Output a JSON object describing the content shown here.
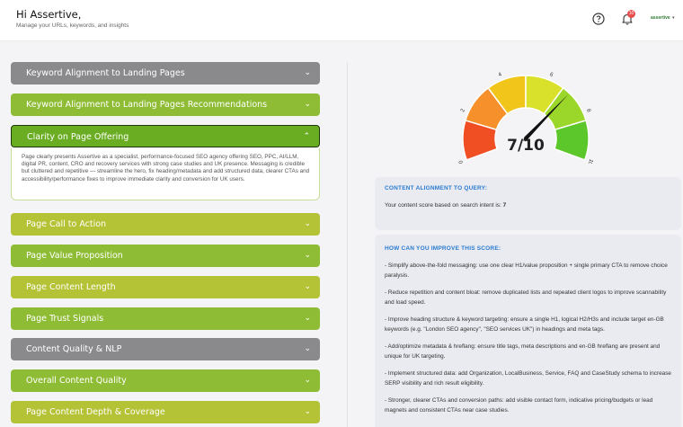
{
  "header": {
    "greeting": "Hi Assertive,",
    "subtitle": "Manage your URLs, keywords, and insights",
    "notification_count": "10",
    "username": "assertive",
    "help_icon": "help-circle-icon",
    "bell_icon": "bell-icon"
  },
  "accordion": [
    {
      "label": "Keyword Alignment to Landing Pages",
      "color": "gray",
      "expanded": false
    },
    {
      "label": "Keyword Alignment to Landing Pages Recommendations",
      "color": "green",
      "expanded": false
    },
    {
      "label": "Clarity on Page Offering",
      "color": "active",
      "expanded": true
    },
    {
      "label": "Page Call to Action",
      "color": "olive",
      "expanded": false
    },
    {
      "label": "Page Value Proposition",
      "color": "green",
      "expanded": false
    },
    {
      "label": "Page Content Length",
      "color": "olive",
      "expanded": false
    },
    {
      "label": "Page Trust Signals",
      "color": "green",
      "expanded": false
    },
    {
      "label": "Content Quality & NLP",
      "color": "gray",
      "expanded": false
    },
    {
      "label": "Overall Content Quality",
      "color": "green",
      "expanded": false
    },
    {
      "label": "Page Content Depth & Coverage",
      "color": "olive",
      "expanded": false
    }
  ],
  "expanded_panel": {
    "text": "Page clearly presents Assertive as a specialist, performance-focused SEO agency offering SEO, PPC, AI/LLM, digital PR, content, CRO and recovery services with strong case studies and UK presence. Messaging is credible but cluttered and repetitive — streamline the hero, fix heading/metadata and add structured data, clearer CTAs and accessibility/performance fixes to improve immediate clarity and conversion for UK users."
  },
  "gauge": {
    "score": 7,
    "max": 10,
    "score_label": "7/10",
    "tick_labels": [
      "0",
      "2",
      "4",
      "6",
      "8",
      "10"
    ],
    "segment_colors": [
      "#f04e23",
      "#f5902b",
      "#f2c51a",
      "#d9e12a",
      "#9bd62a",
      "#5cc72a"
    ]
  },
  "alignment_card": {
    "title": "CONTENT ALIGNMENT TO QUERY:",
    "body_prefix": "Your content score based on search intent is: ",
    "body_score": "7"
  },
  "improve_card": {
    "title": "HOW CAN YOU IMPROVE THIS SCORE:",
    "tips": [
      "- Simplify above-the-fold messaging: use one clear H1/value proposition + single primary CTA to remove choice paralysis.",
      "- Reduce repetition and content bloat: remove duplicated lists and repeated client logos to improve scannability and load speed.",
      "- Improve heading structure & keyword targeting: ensure a single H1, logical H2/H3s and include target en-GB keywords (e.g. \"London SEO agency\", \"SEO services UK\") in headings and meta tags.",
      "- Add/optimize metadata & hreflang: ensure title tags, meta descriptions and en-GB hreflang are present and unique for UK targeting.",
      "- Implement structured data: add Organization, LocalBusiness, Service, FAQ and CaseStudy schema to increase SERP visibility and rich result eligibility.",
      "- Stronger, clearer CTAs and conversion paths: add visible contact form, indicative pricing/budgets or lead magnets and consistent CTAs near case studies."
    ]
  }
}
